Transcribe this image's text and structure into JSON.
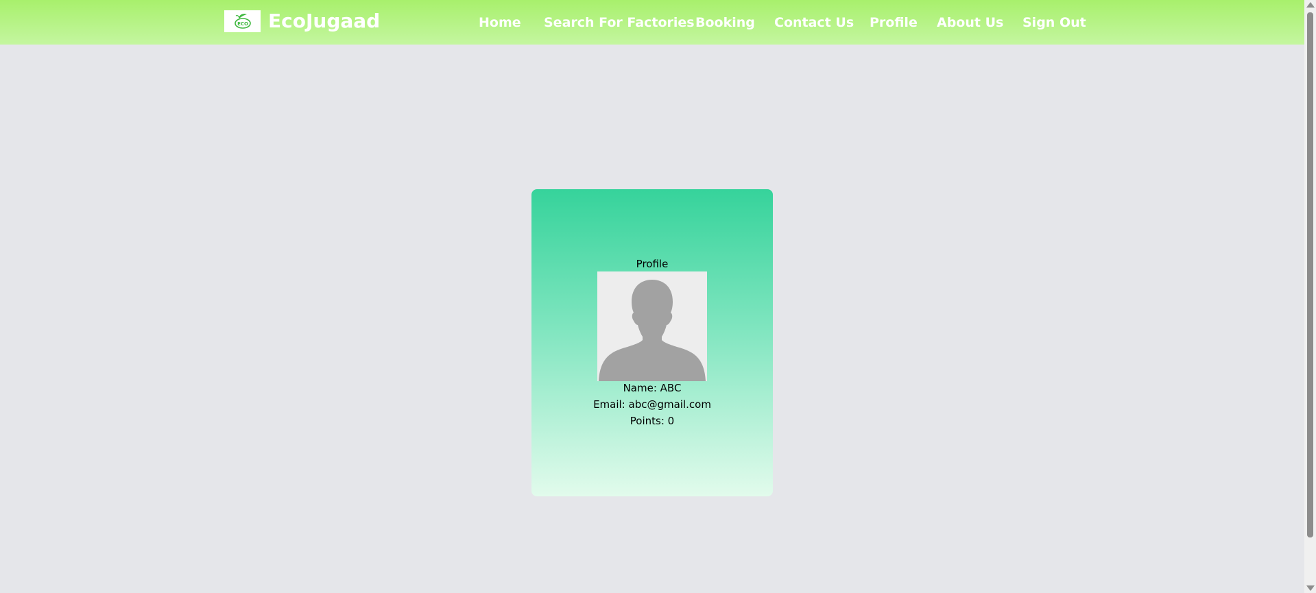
{
  "header": {
    "brand": "EcoJugaad",
    "logo_text": "ECO",
    "nav": [
      "Home",
      "Search For Factories",
      "Booking",
      "Contact Us",
      "Profile",
      "About Us",
      "Sign Out"
    ]
  },
  "profile_card": {
    "title": "Profile",
    "avatar_icon": "person-silhouette-icon",
    "name_line": "Name: ABC",
    "email_line": "Email: abc@gmail.com",
    "points_line": "Points: 0"
  },
  "colors": {
    "nav_top": "#a8f06c",
    "nav_bottom": "#c4f6a0",
    "card_top": "#36d39b",
    "card_bottom": "#e2fbec",
    "page_bg": "#e5e6ea",
    "logo_green": "#3fb83f"
  }
}
